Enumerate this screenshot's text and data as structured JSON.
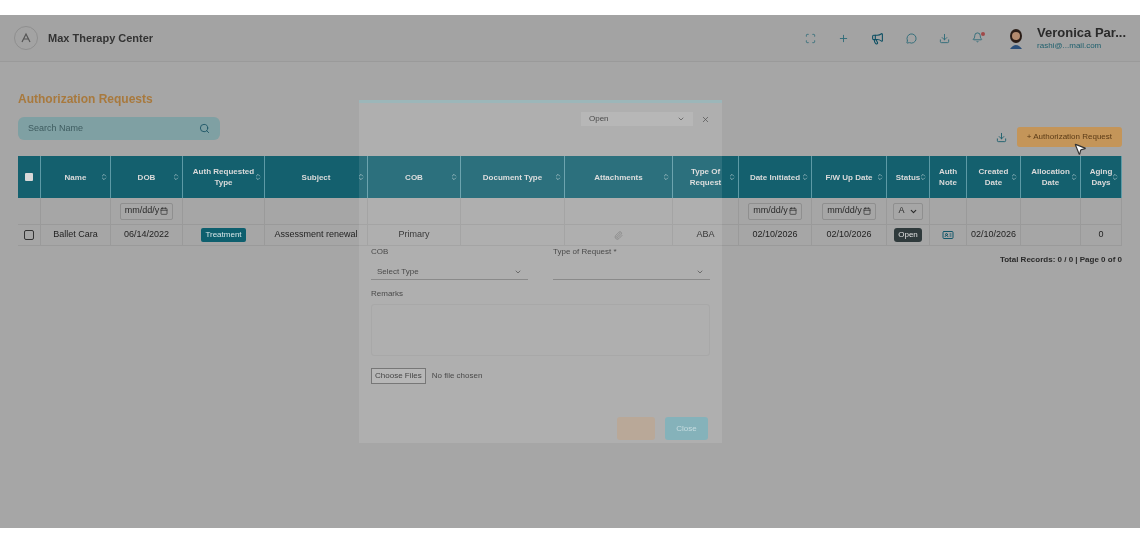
{
  "header": {
    "app_name": "Max Therapy Center",
    "user_name": "Veronica Par...",
    "user_email": "rashi@...mail.com"
  },
  "page": {
    "title": "Authorization Requests",
    "search": {
      "placeholder": "Search Name"
    },
    "add_button": "+ Authorization Request"
  },
  "table": {
    "select_all_checked": false,
    "columns": [
      {
        "kind": "checkbox",
        "sortable": false
      },
      {
        "kind": "text",
        "label": "Name",
        "sortable": true
      },
      {
        "kind": "text",
        "label": "DOB",
        "sortable": true,
        "filter": {
          "kind": "date",
          "placeholder": "mm/dd/y"
        }
      },
      {
        "kind": "text",
        "label": "Auth Requested Type",
        "sortable": true
      },
      {
        "kind": "text",
        "label": "Subject",
        "sortable": true
      },
      {
        "kind": "text",
        "label": "COB",
        "sortable": true
      },
      {
        "kind": "text",
        "label": "Document Type",
        "sortable": true
      },
      {
        "kind": "text",
        "label": "Attachments",
        "sortable": true
      },
      {
        "kind": "text",
        "label": "Type Of Request",
        "sortable": true
      },
      {
        "kind": "text",
        "label": "Date Initiated",
        "sortable": true,
        "filter": {
          "kind": "date",
          "placeholder": "mm/dd/y"
        }
      },
      {
        "kind": "text",
        "label": "F/W Up Date",
        "sortable": true,
        "filter": {
          "kind": "date",
          "placeholder": "mm/dd/y"
        }
      },
      {
        "kind": "text",
        "label": "Status",
        "sortable": true,
        "filter": {
          "kind": "select",
          "value": "A"
        }
      },
      {
        "kind": "text",
        "label": "Auth Note",
        "sortable": false
      },
      {
        "kind": "text",
        "label": "Created Date",
        "sortable": true
      },
      {
        "kind": "text",
        "label": "Allocation Date",
        "sortable": true
      },
      {
        "kind": "text",
        "label": "Aging Days",
        "sortable": true
      }
    ],
    "rows": [
      {
        "checked": false,
        "cells": [
          {
            "kind": "checkbox"
          },
          {
            "kind": "text",
            "text": "Ballet Cara"
          },
          {
            "kind": "text",
            "text": "06/14/2022"
          },
          {
            "kind": "badge",
            "text": "Treatment"
          },
          {
            "kind": "text",
            "text": "Assessment renewal"
          },
          {
            "kind": "text",
            "text": "Primary"
          },
          {
            "kind": "empty"
          },
          {
            "kind": "icon"
          },
          {
            "kind": "text",
            "text": "ABA"
          },
          {
            "kind": "text",
            "text": "02/10/2026"
          },
          {
            "kind": "text",
            "text": "02/10/2026"
          },
          {
            "kind": "status",
            "text": "Open"
          },
          {
            "kind": "note"
          },
          {
            "kind": "text",
            "text": "02/10/2026"
          },
          {
            "kind": "empty"
          },
          {
            "kind": "text",
            "text": "0"
          }
        ]
      }
    ],
    "footer": "Total Records: 0 / 0 | Page 0 of 0"
  },
  "modal": {
    "status_select": "Open",
    "cob_label": "COB",
    "type_label": "Type of Request *",
    "cob_select": "Select Type",
    "remarks_label": "Remarks",
    "file_button": "Choose Files",
    "file_status": "No file chosen",
    "close_button": "Close"
  }
}
